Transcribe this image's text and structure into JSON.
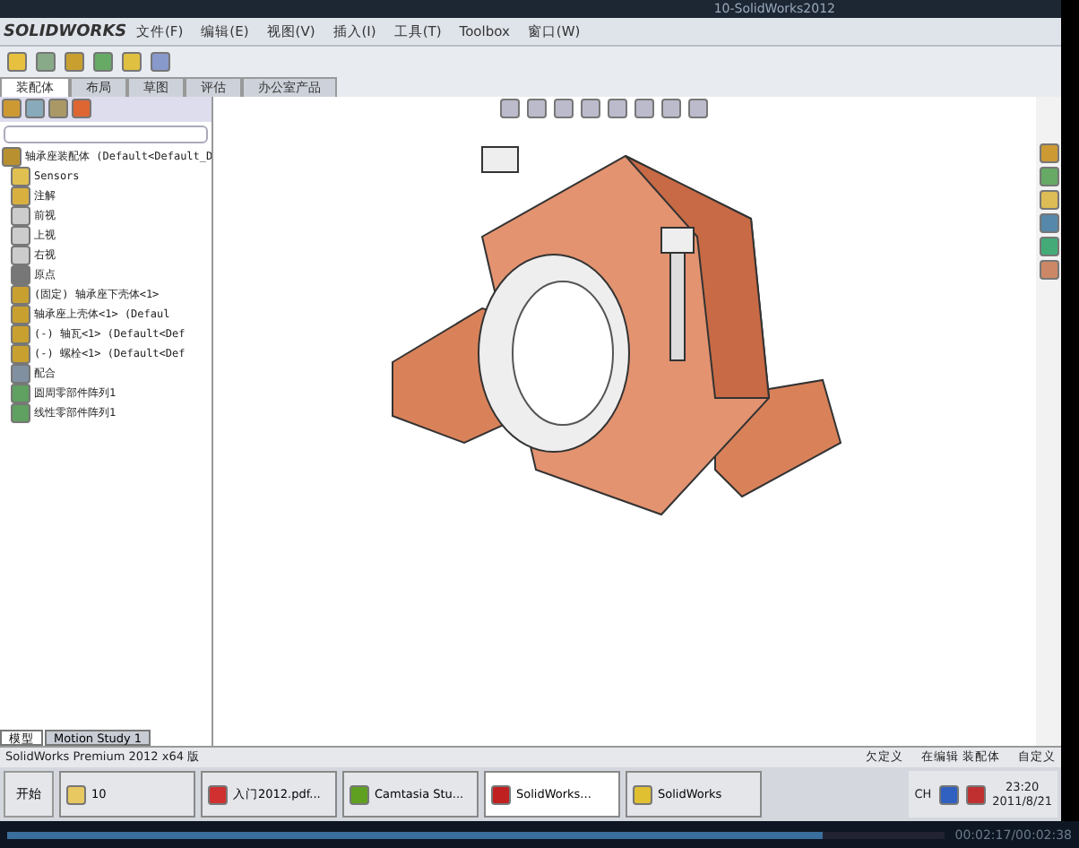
{
  "window": {
    "title": "10-SolidWorks2012"
  },
  "app": {
    "logo": "SOLIDWORKS"
  },
  "menu": [
    "文件(F)",
    "编辑(E)",
    "视图(V)",
    "插入(I)",
    "工具(T)",
    "Toolbox",
    "窗口(W)"
  ],
  "command_tabs": [
    {
      "label": "装配体",
      "selected": true
    },
    {
      "label": "布局",
      "selected": false
    },
    {
      "label": "草图",
      "selected": false
    },
    {
      "label": "评估",
      "selected": false
    },
    {
      "label": "办公室产品",
      "selected": false
    }
  ],
  "tree": {
    "root": "轴承座装配体 (Default<Default_D",
    "items": [
      {
        "kind": "sensor",
        "label": "Sensors"
      },
      {
        "kind": "annotation",
        "label": "注解"
      },
      {
        "kind": "plane",
        "label": "前视"
      },
      {
        "kind": "plane",
        "label": "上视"
      },
      {
        "kind": "plane",
        "label": "右视"
      },
      {
        "kind": "origin",
        "label": "原点"
      },
      {
        "kind": "part",
        "label": "(固定) 轴承座下壳体<1>"
      },
      {
        "kind": "part",
        "label": "轴承座上壳体<1> (Defaul"
      },
      {
        "kind": "part",
        "label": "(-) 轴瓦<1> (Default<Def"
      },
      {
        "kind": "part",
        "label": "(-) 螺栓<1> (Default<Def"
      },
      {
        "kind": "mates",
        "label": "配合"
      },
      {
        "kind": "pattern",
        "label": "圆周零部件阵列1"
      },
      {
        "kind": "pattern",
        "label": "线性零部件阵列1"
      }
    ]
  },
  "bottom_tabs": [
    {
      "label": "模型",
      "selected": true
    },
    {
      "label": "Motion Study 1",
      "selected": false
    }
  ],
  "status_bar": {
    "text": "SolidWorks Premium 2012 x64 版",
    "fields": [
      "欠定义",
      "在编辑 装配体",
      "自定义"
    ]
  },
  "taskbar": {
    "start": "开始",
    "tasks": [
      {
        "kind": "folder",
        "label": "10",
        "selected": false
      },
      {
        "kind": "pdf",
        "label": "入门2012.pdf...",
        "selected": false
      },
      {
        "kind": "camtasia",
        "label": "Camtasia Stu...",
        "selected": false
      },
      {
        "kind": "solidworks",
        "label": "SolidWorks...",
        "selected": true
      },
      {
        "kind": "key",
        "label": "SolidWorks",
        "selected": false
      }
    ],
    "language": "CH",
    "time": "23:20",
    "date": "2011/8/21"
  },
  "player": {
    "level": 0.87,
    "time": "00:02:17/00:02:38"
  }
}
